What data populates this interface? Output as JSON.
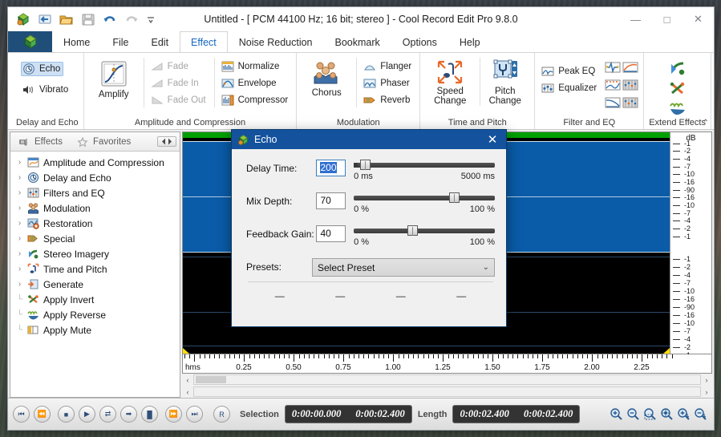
{
  "window": {
    "title": "Untitled - [ PCM 44100 Hz; 16 bit; stereo ] - Cool Record Edit Pro 9.8.0",
    "minimize_label": "—",
    "maximize_label": "□",
    "close_label": "✕"
  },
  "quick_access": [
    {
      "name": "app-logo-icon",
      "label": "app"
    },
    {
      "name": "new-icon",
      "label": "new"
    },
    {
      "name": "open-icon",
      "label": "open"
    },
    {
      "name": "save-icon",
      "label": "save"
    },
    {
      "name": "undo-icon",
      "label": "undo"
    },
    {
      "name": "redo-icon",
      "label": "redo"
    },
    {
      "name": "customize-qat-icon",
      "label": "≡"
    }
  ],
  "tabs": [
    {
      "label": "Home",
      "active": false
    },
    {
      "label": "File",
      "active": false
    },
    {
      "label": "Edit",
      "active": false
    },
    {
      "label": "Effect",
      "active": true
    },
    {
      "label": "Noise Reduction",
      "active": false
    },
    {
      "label": "Bookmark",
      "active": false
    },
    {
      "label": "Options",
      "active": false
    },
    {
      "label": "Help",
      "active": false
    }
  ],
  "ribbon": {
    "expander_label": "⌃",
    "groups": [
      {
        "label": "Delay and Echo",
        "items": [
          {
            "label": "Echo",
            "selected": true
          },
          {
            "label": "Vibrato",
            "selected": false
          }
        ]
      },
      {
        "label": "Amplitude and Compression",
        "big": {
          "label": "Amplify"
        },
        "col1": [
          {
            "label": "Fade",
            "disabled": true
          },
          {
            "label": "Fade In",
            "disabled": true
          },
          {
            "label": "Fade Out",
            "disabled": true
          }
        ],
        "col2": [
          {
            "label": "Normalize",
            "disabled": false
          },
          {
            "label": "Envelope",
            "disabled": false
          },
          {
            "label": "Compressor",
            "disabled": false
          }
        ]
      },
      {
        "label": "Modulation",
        "big": {
          "label": "Chorus"
        },
        "col1": [
          {
            "label": "Flanger",
            "disabled": false
          },
          {
            "label": "Phaser",
            "disabled": false
          },
          {
            "label": "Reverb",
            "disabled": false
          }
        ]
      },
      {
        "label": "Time and Pitch",
        "items": [
          {
            "label": "Speed\nChange"
          },
          {
            "label": "Pitch\nChange"
          }
        ]
      },
      {
        "label": "Filter and EQ",
        "col1": [
          {
            "label": "Peak EQ"
          },
          {
            "label": "Equalizer"
          }
        ],
        "icon_grid": 6
      },
      {
        "label": "Extend Effects",
        "icon_count": 3
      }
    ]
  },
  "left_panel": {
    "tabs": [
      {
        "label": "Effects",
        "icon": "effects-icon",
        "active": true
      },
      {
        "label": "Favorites",
        "icon": "star-icon",
        "active": false
      }
    ],
    "nav_label": "◀▶",
    "tree": [
      {
        "label": "Amplitude and Compression",
        "expandable": true
      },
      {
        "label": "Delay and Echo",
        "expandable": true
      },
      {
        "label": "Filters and EQ",
        "expandable": true
      },
      {
        "label": "Modulation",
        "expandable": true
      },
      {
        "label": "Restoration",
        "expandable": true
      },
      {
        "label": "Special",
        "expandable": true
      },
      {
        "label": "Stereo Imagery",
        "expandable": true
      },
      {
        "label": "Time and Pitch",
        "expandable": true
      },
      {
        "label": "Generate",
        "expandable": true
      },
      {
        "label": "Apply Invert",
        "expandable": false
      },
      {
        "label": "Apply Reverse",
        "expandable": false
      },
      {
        "label": "Apply Mute",
        "expandable": false
      }
    ]
  },
  "waveform": {
    "db_title": "dB",
    "db_labels": [
      "-1",
      "-2",
      "-4",
      "-7",
      "-10",
      "-16",
      "-90",
      "-16",
      "-10",
      "-7",
      "-4",
      "-2",
      "-1"
    ],
    "ruler_unit": "hms",
    "ruler_ticks": [
      "0.25",
      "0.50",
      "0.75",
      "1.00",
      "1.25",
      "1.50",
      "1.75",
      "2.00",
      "2.25"
    ],
    "scroll_left_arrow": "‹",
    "scroll_right_arrow": "›"
  },
  "transport": {
    "buttons": [
      {
        "name": "skip-start-button",
        "glyph": "⏮"
      },
      {
        "name": "rewind-button",
        "glyph": "⏪"
      },
      {
        "name": "stop-button",
        "glyph": "■"
      },
      {
        "name": "play-button",
        "glyph": "▶"
      },
      {
        "name": "loop-button",
        "glyph": "⇄"
      },
      {
        "name": "play-to-end-button",
        "glyph": "➡"
      },
      {
        "name": "pause-button",
        "glyph": "▐▌"
      },
      {
        "name": "fast-forward-button",
        "glyph": "⏩"
      },
      {
        "name": "skip-end-button",
        "glyph": "⏭"
      },
      {
        "name": "record-button",
        "glyph": "R"
      }
    ],
    "selection_label": "Selection",
    "selection_start": "0:00:00.000",
    "selection_end": "0:00:02.400",
    "length_label": "Length",
    "length_value": "0:00:02.400",
    "total_value": "0:00:02.400",
    "zoom_buttons": [
      {
        "name": "zoom-in-button"
      },
      {
        "name": "zoom-out-button"
      },
      {
        "name": "zoom-selection-button"
      },
      {
        "name": "zoom-full-button"
      },
      {
        "name": "zoom-in-vertical-button"
      },
      {
        "name": "zoom-out-vertical-button"
      }
    ]
  },
  "dialog": {
    "title": "Echo",
    "close_label": "✕",
    "fields": [
      {
        "label": "Delay Time:",
        "value": "200",
        "focused": true,
        "min_label": "0 ms",
        "max_label": "5000 ms",
        "thumb_pct": 4
      },
      {
        "label": "Mix Depth:",
        "value": "70",
        "focused": false,
        "min_label": "0 %",
        "max_label": "100 %",
        "thumb_pct": 70
      },
      {
        "label": "Feedback Gain:",
        "value": "40",
        "focused": false,
        "min_label": "0 %",
        "max_label": "100 %",
        "thumb_pct": 40
      }
    ],
    "presets_label": "Presets:",
    "presets_value": "Select Preset",
    "presets_chevron": "⌄",
    "buttons": [
      {
        "label": "—"
      },
      {
        "label": "—"
      },
      {
        "label": "—"
      },
      {
        "label": "—"
      }
    ]
  }
}
